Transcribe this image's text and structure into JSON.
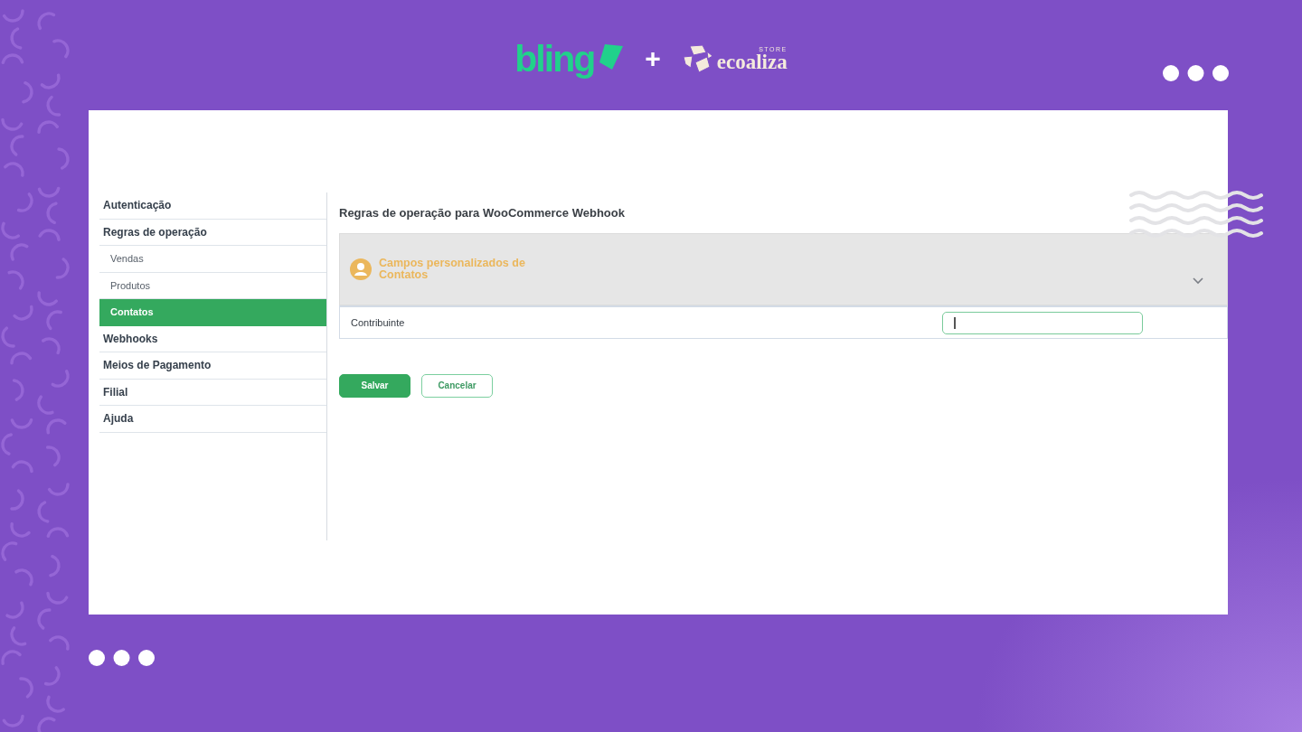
{
  "branding": {
    "partner_logo": "bling",
    "separator": "+",
    "store_logo": "ecoaliza",
    "store_logo_tag": "STORE"
  },
  "app": {
    "sidebar": {
      "items": [
        {
          "label": "Autenticação",
          "selected": false
        },
        {
          "label": "Regras de operação",
          "selected": false,
          "children": [
            {
              "label": "Vendas",
              "selected": false
            },
            {
              "label": "Produtos",
              "selected": false
            },
            {
              "label": "Contatos",
              "selected": true
            }
          ]
        },
        {
          "label": "Webhooks",
          "selected": false
        },
        {
          "label": "Meios de Pagamento",
          "selected": false
        },
        {
          "label": "Filial",
          "selected": false
        },
        {
          "label": "Ajuda",
          "selected": false
        }
      ]
    },
    "title": "Regras de operação para WooCommerce Webhook",
    "section": {
      "title": "Campos personalizados de Contatos",
      "fields": [
        {
          "label": "Contribuinte",
          "focused": true
        }
      ]
    },
    "buttons": [
      {
        "label": "Salvar",
        "kind": "primary"
      },
      {
        "label": "Cancelar",
        "kind": "outline"
      }
    ]
  }
}
